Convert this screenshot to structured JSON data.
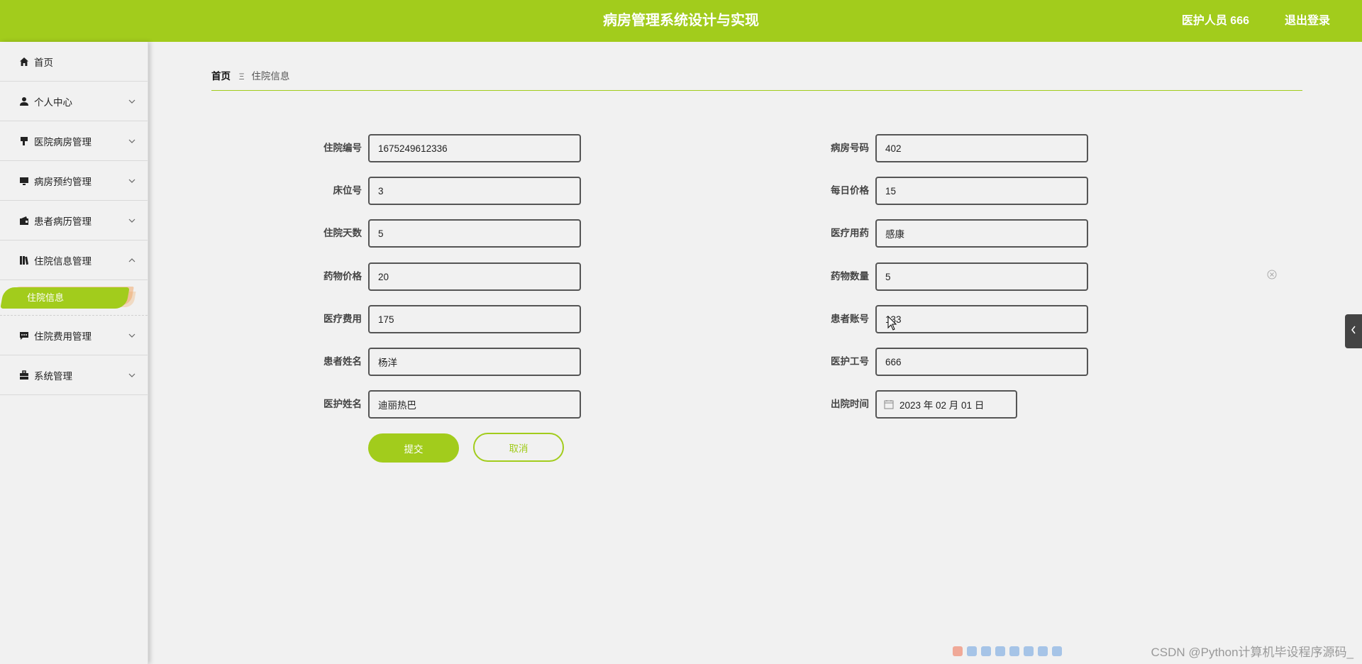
{
  "header": {
    "title": "病房管理系统设计与实现",
    "user_label": "医护人员 666",
    "logout_label": "退出登录",
    "accent_color": "#a2cc1c"
  },
  "sidebar": {
    "items": [
      {
        "label": "首页",
        "icon": "home-icon"
      },
      {
        "label": "个人中心",
        "icon": "user-icon"
      },
      {
        "label": "医院病房管理",
        "icon": "bed-icon"
      },
      {
        "label": "病房预约管理",
        "icon": "monitor-icon"
      },
      {
        "label": "患者病历管理",
        "icon": "wallet-icon"
      },
      {
        "label": "住院信息管理",
        "icon": "books-icon",
        "expanded": true
      },
      {
        "label": "住院费用管理",
        "icon": "chat-icon"
      },
      {
        "label": "系统管理",
        "icon": "briefcase-icon"
      }
    ],
    "active_sub": "住院信息"
  },
  "breadcrumb": {
    "home": "首页",
    "separator": "Ξ",
    "current": "住院信息"
  },
  "form": {
    "left": [
      {
        "label": "住院编号",
        "value": "1675249612336"
      },
      {
        "label": "床位号",
        "value": "3"
      },
      {
        "label": "住院天数",
        "value": "5"
      },
      {
        "label": "药物价格",
        "value": "20"
      },
      {
        "label": "医疗费用",
        "value": "175"
      },
      {
        "label": "患者姓名",
        "value": "杨洋"
      },
      {
        "label": "医护姓名",
        "value": "迪丽热巴"
      }
    ],
    "right": [
      {
        "label": "病房号码",
        "value": "402"
      },
      {
        "label": "每日价格",
        "value": "15"
      },
      {
        "label": "医疗用药",
        "value": "感康"
      },
      {
        "label": "药物数量",
        "value": "5"
      },
      {
        "label": "患者账号",
        "value": "133"
      },
      {
        "label": "医护工号",
        "value": "666"
      },
      {
        "label": "出院时间",
        "value": "2023 年 02 月 01 日"
      }
    ],
    "submit_label": "提交",
    "cancel_label": "取消"
  },
  "watermark": "CSDN @Python计算机毕设程序源码_"
}
